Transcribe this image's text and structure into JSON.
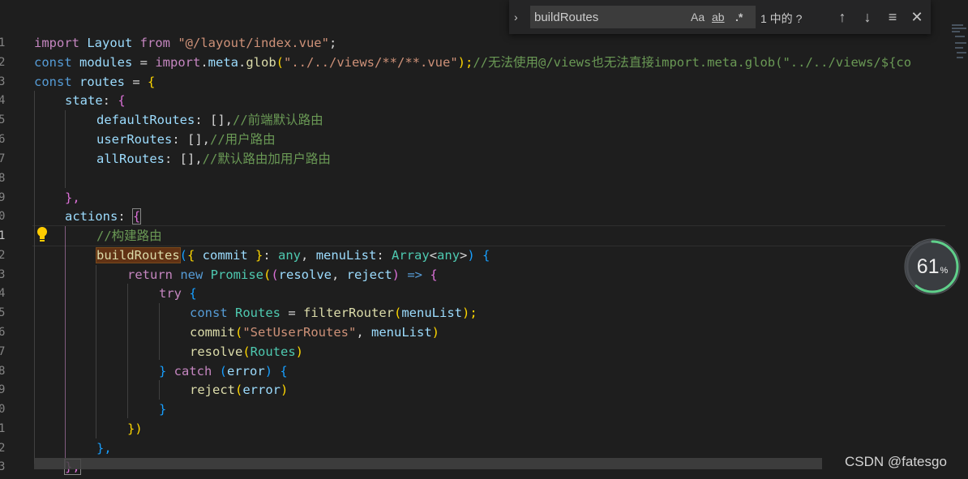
{
  "line_numbers": [
    "1",
    "2",
    "3",
    "4",
    "5",
    "6",
    "7",
    "8",
    "9",
    "0",
    "1",
    "2",
    "3",
    "4",
    "5",
    "6",
    "7",
    "8",
    "9",
    "0",
    "1",
    "2",
    "3"
  ],
  "code": {
    "l1": {
      "t1": "import ",
      "t2": "Layout ",
      "t3": "from ",
      "t4": "\"@/layout/index.vue\"",
      "t5": ";"
    },
    "l2": {
      "t1": "const ",
      "t2": "modules ",
      "t3": "= ",
      "t4": "import",
      "t5": ".",
      "t6": "meta",
      "t7": ".",
      "t8": "glob",
      "t9": "(",
      "t10": "\"../../views/**/**.vue\"",
      "t11": ");",
      "t12": "//无法使用@/views也无法直接import.meta.glob(\"../../views/${co"
    },
    "l3": {
      "t1": "const ",
      "t2": "routes ",
      "t3": "= ",
      "t4": "{"
    },
    "l4": {
      "t1": "state",
      "t2": ": ",
      "t3": "{"
    },
    "l5": {
      "t1": "defaultRoutes",
      "t2": ": [],",
      "t3": "//前端默认路由"
    },
    "l6": {
      "t1": "userRoutes",
      "t2": ": [],",
      "t3": "//用户路由"
    },
    "l7": {
      "t1": "allRoutes",
      "t2": ": [],",
      "t3": "//默认路由加用户路由"
    },
    "l9": {
      "t1": "},"
    },
    "l10": {
      "t1": "actions",
      "t2": ": ",
      "t3": "{"
    },
    "l11": {
      "t1": "//构建路由"
    },
    "l12": {
      "t1": "buildRoutes",
      "t2": "(",
      "t3": "{ ",
      "t4": "commit ",
      "t5": "}",
      "t6": ": ",
      "t7": "any",
      "t8": ", ",
      "t9": "menuList",
      "t10": ": ",
      "t11": "Array",
      "t12": "<",
      "t13": "any",
      "t14": ">",
      "t15": ")",
      "t16": " {"
    },
    "l13": {
      "t1": "return ",
      "t2": "new ",
      "t3": "Promise",
      "t4": "(",
      "t5": "(",
      "t6": "resolve",
      "t7": ", ",
      "t8": "reject",
      "t9": ")",
      "t10": " => ",
      "t11": "{"
    },
    "l14": {
      "t1": "try ",
      "t2": "{"
    },
    "l15": {
      "t1": "const ",
      "t2": "Routes ",
      "t3": "= ",
      "t4": "filterRouter",
      "t5": "(",
      "t6": "menuList",
      "t7": ");"
    },
    "l16": {
      "t1": "commit",
      "t2": "(",
      "t3": "\"SetUserRoutes\"",
      "t4": ", ",
      "t5": "menuList",
      "t6": ")"
    },
    "l17": {
      "t1": "resolve",
      "t2": "(",
      "t3": "Routes",
      "t4": ")"
    },
    "l18": {
      "t1": "} ",
      "t2": "catch ",
      "t3": "(",
      "t4": "error",
      "t5": ") ",
      "t6": "{"
    },
    "l19": {
      "t1": "reject",
      "t2": "(",
      "t3": "error",
      "t4": ")"
    },
    "l20": {
      "t1": "}"
    },
    "l21": {
      "t1": "})"
    },
    "l22": {
      "t1": "},"
    },
    "l23": {
      "t1": "},"
    }
  },
  "find_widget": {
    "query": "buildRoutes",
    "match_case": "Aa",
    "whole_word": "ab",
    "regex": ".*",
    "result_count": "1 中的 ?"
  },
  "gauge": {
    "value": "61",
    "unit": "%",
    "fraction": 0.61
  },
  "watermark": "CSDN @fatesgo",
  "colors": {
    "keyword": "#569cd6",
    "string": "#ce9178",
    "comment": "#6a9955",
    "function": "#dcdcaa",
    "variable": "#9cdcfe",
    "type": "#4ec9b0",
    "find_highlight": "#613214"
  }
}
